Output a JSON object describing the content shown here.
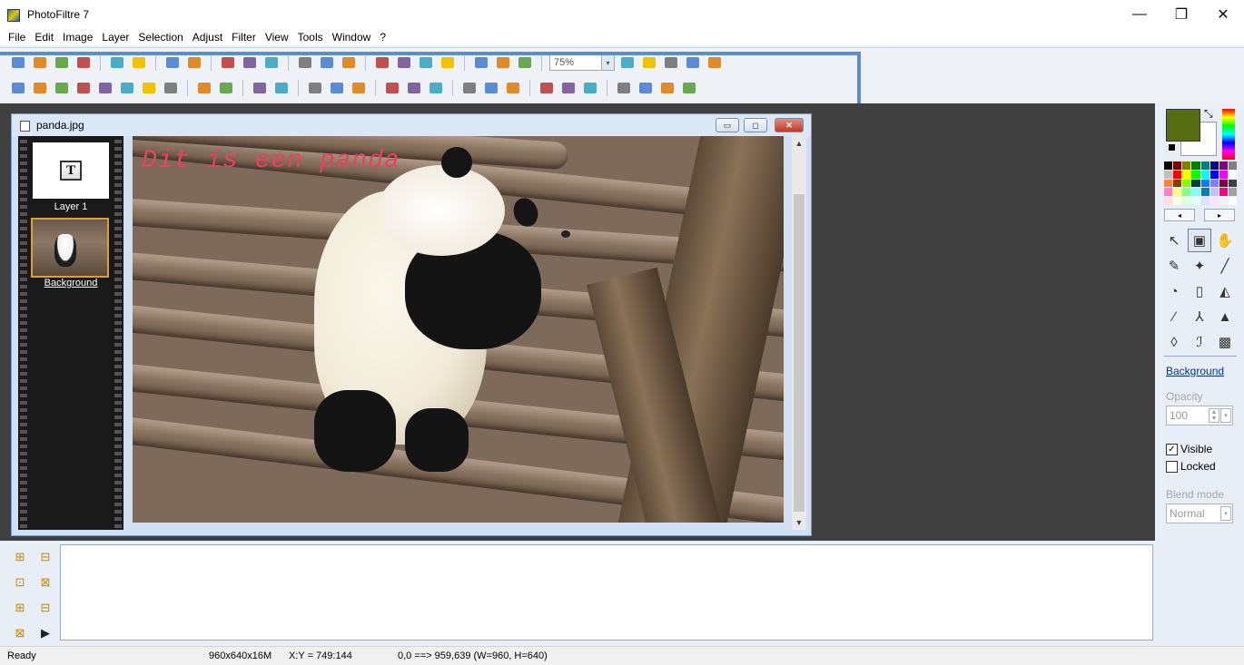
{
  "app": {
    "title": "PhotoFiltre 7"
  },
  "window_controls": {
    "minimize": "—",
    "maximize": "❐",
    "close": "✕"
  },
  "menu": [
    "File",
    "Edit",
    "Image",
    "Layer",
    "Selection",
    "Adjust",
    "Filter",
    "View",
    "Tools",
    "Window",
    "?"
  ],
  "toolbar": {
    "zoom_value": "75%",
    "row1_icons": [
      "new-icon",
      "open-icon",
      "save-icon",
      "print-icon",
      "sep",
      "copy-icon",
      "paste-icon",
      "sep",
      "undo-icon",
      "redo-icon",
      "sep",
      "image-size-icon",
      "canvas-size-icon",
      "crop-icon",
      "sep",
      "rotate-icon",
      "flip-icon",
      "mirror-icon",
      "sep",
      "text-icon",
      "frame-icon",
      "filter-icon",
      "shape-icon",
      "sep",
      "browser-icon",
      "plugin-icon",
      "gallery-icon",
      "sep",
      "zoom-box",
      "zoom-in-icon",
      "zoom-out-icon",
      "fit-icon",
      "actual-size-icon",
      "fullscreen-icon"
    ],
    "row2_icons": [
      "brightness-minus-icon",
      "brightness-plus-icon",
      "contrast-minus-icon",
      "contrast-plus-icon",
      "gamma-minus-icon",
      "gamma-plus-icon",
      "saturation-minus-icon",
      "saturation-plus-icon",
      "sep",
      "hue-icon",
      "balance-icon",
      "sep",
      "auto-levels-icon",
      "auto-contrast-icon",
      "sep",
      "grid1-icon",
      "grid2-icon",
      "grid3-icon",
      "sep",
      "grayscale-icon",
      "blur-icon",
      "sharpen-icon",
      "sep",
      "emboss-icon",
      "soften-icon",
      "sharpen-more-icon",
      "sep",
      "color-monitor-icon",
      "monitor2-icon",
      "effect-icon",
      "sep",
      "book-icon",
      "print2-icon",
      "export-icon",
      "scan-icon"
    ]
  },
  "document": {
    "title": "panda.jpg",
    "min_label": "▭",
    "max_label": "◻",
    "close_label": "✕",
    "canvas_text": "Dit is een panda"
  },
  "layers": [
    {
      "label": "Layer 1",
      "glyph": "T"
    },
    {
      "label": "Background"
    }
  ],
  "colors": {
    "foreground": "#566d12",
    "background": "#ffffff",
    "accent_highlight": "#5a8ec8",
    "canvas_text": "#e8425f",
    "palette": [
      "#000000",
      "#800000",
      "#808000",
      "#008000",
      "#008080",
      "#000080",
      "#800080",
      "#808080",
      "#c0c0c0",
      "#ff0000",
      "#ffff00",
      "#00ff00",
      "#00ffff",
      "#0000ff",
      "#ff00ff",
      "#ffffff",
      "#ff8040",
      "#804000",
      "#80ff00",
      "#004040",
      "#0080ff",
      "#8080ff",
      "#800040",
      "#404040",
      "#ff80c0",
      "#ffff80",
      "#80ff80",
      "#80ffff",
      "#0080c0",
      "#c0c0ff",
      "#ff0080",
      "#a0a0a0",
      "#ffe0e0",
      "#ffffe0",
      "#e0ffe0",
      "#e0ffff",
      "#e0e0ff",
      "#ffe0ff",
      "#f0f0f0",
      "#ffffff"
    ]
  },
  "right_panel": {
    "pal_prev": "◂",
    "pal_next": "▸",
    "tools": [
      "pointer-icon",
      "selection-icon",
      "hand-icon",
      "dropper-icon",
      "magic-wand-icon",
      "line-icon",
      "fill-icon",
      "spray-icon",
      "eraser-icon",
      "brush-icon",
      "advanced-brush-icon",
      "clone-icon",
      "blur-drop-icon",
      "smudge-icon",
      "stamp-image-icon"
    ],
    "tool_glyphs": [
      "↖",
      "▣",
      "✋",
      "✎",
      "✦",
      "╱",
      "◔",
      "▯",
      "◭",
      "∕",
      "⅄",
      "▲",
      "◊",
      "ℐ",
      "▩"
    ],
    "layer_name": "Background",
    "opacity_label": "Opacity",
    "opacity_value": "100",
    "visible_label": "Visible",
    "visible_checked": "✓",
    "locked_label": "Locked",
    "blend_label": "Blend mode",
    "blend_value": "Normal"
  },
  "bottom_panel": {
    "icons": [
      "tree-icon-1",
      "tree-icon-2",
      "tree-icon-3",
      "tree-icon-4",
      "tree-icon-5",
      "tree-icon-6",
      "tree-icon-7",
      "play-icon"
    ],
    "glyphs": [
      "⊞",
      "⊟",
      "⊡",
      "⊠",
      "⊞",
      "⊟",
      "⊠",
      "▶"
    ]
  },
  "status": {
    "state": "Ready",
    "image_info": "960x640x16M",
    "cursor": "X:Y = 749:144",
    "selection": "0,0 ==> 959,639 (W=960, H=640)"
  }
}
